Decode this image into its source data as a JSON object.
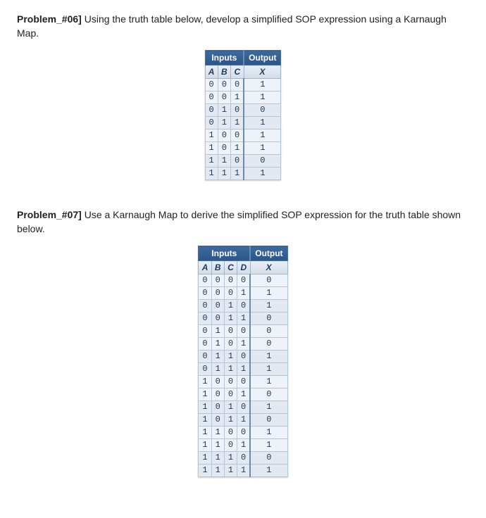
{
  "problem06": {
    "label": "Problem_#06]",
    "text": " Using the truth table below, develop a simplified SOP expression using a Karnaugh Map.",
    "headers": {
      "inputs": "Inputs",
      "output": "Output"
    },
    "sub": {
      "a": "A",
      "b": "B",
      "c": "C",
      "x": "X"
    },
    "rows": [
      {
        "a": "0",
        "b": "0",
        "c": "0",
        "x": "1"
      },
      {
        "a": "0",
        "b": "0",
        "c": "1",
        "x": "1"
      },
      {
        "a": "0",
        "b": "1",
        "c": "0",
        "x": "0"
      },
      {
        "a": "0",
        "b": "1",
        "c": "1",
        "x": "1"
      },
      {
        "a": "1",
        "b": "0",
        "c": "0",
        "x": "1"
      },
      {
        "a": "1",
        "b": "0",
        "c": "1",
        "x": "1"
      },
      {
        "a": "1",
        "b": "1",
        "c": "0",
        "x": "0"
      },
      {
        "a": "1",
        "b": "1",
        "c": "1",
        "x": "1"
      }
    ]
  },
  "problem07": {
    "label": "Problem_#07]",
    "text": "  Use a Karnaugh Map to derive the simplified SOP expression for the truth table shown below.",
    "headers": {
      "inputs": "Inputs",
      "output": "Output"
    },
    "sub": {
      "a": "A",
      "b": "B",
      "c": "C",
      "d": "D",
      "x": "X"
    },
    "rows": [
      {
        "a": "0",
        "b": "0",
        "c": "0",
        "d": "0",
        "x": "0"
      },
      {
        "a": "0",
        "b": "0",
        "c": "0",
        "d": "1",
        "x": "1"
      },
      {
        "a": "0",
        "b": "0",
        "c": "1",
        "d": "0",
        "x": "1"
      },
      {
        "a": "0",
        "b": "0",
        "c": "1",
        "d": "1",
        "x": "0"
      },
      {
        "a": "0",
        "b": "1",
        "c": "0",
        "d": "0",
        "x": "0"
      },
      {
        "a": "0",
        "b": "1",
        "c": "0",
        "d": "1",
        "x": "0"
      },
      {
        "a": "0",
        "b": "1",
        "c": "1",
        "d": "0",
        "x": "1"
      },
      {
        "a": "0",
        "b": "1",
        "c": "1",
        "d": "1",
        "x": "1"
      },
      {
        "a": "1",
        "b": "0",
        "c": "0",
        "d": "0",
        "x": "1"
      },
      {
        "a": "1",
        "b": "0",
        "c": "0",
        "d": "1",
        "x": "0"
      },
      {
        "a": "1",
        "b": "0",
        "c": "1",
        "d": "0",
        "x": "1"
      },
      {
        "a": "1",
        "b": "0",
        "c": "1",
        "d": "1",
        "x": "0"
      },
      {
        "a": "1",
        "b": "1",
        "c": "0",
        "d": "0",
        "x": "1"
      },
      {
        "a": "1",
        "b": "1",
        "c": "0",
        "d": "1",
        "x": "1"
      },
      {
        "a": "1",
        "b": "1",
        "c": "1",
        "d": "0",
        "x": "0"
      },
      {
        "a": "1",
        "b": "1",
        "c": "1",
        "d": "1",
        "x": "1"
      }
    ]
  }
}
